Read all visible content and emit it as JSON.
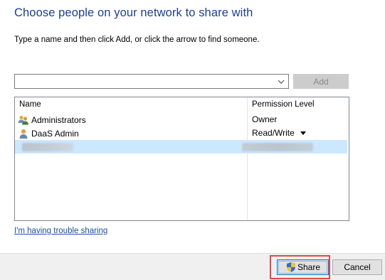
{
  "dialog": {
    "title": "Choose people on your network to share with",
    "instructions": "Type a name and then click Add, or click the arrow to find someone."
  },
  "add_bar": {
    "input_value": "",
    "add_label": "Add"
  },
  "list": {
    "columns": [
      "Name",
      "Permission Level"
    ],
    "rows": [
      {
        "name": "Administrators",
        "permission": "Owner",
        "icon": "group-users-icon"
      },
      {
        "name": "DaaS Admin",
        "permission": "Read/Write",
        "icon": "user-icon",
        "has_dropdown": true
      }
    ]
  },
  "help_link": "I'm having trouble sharing",
  "footer": {
    "share_label": "Share",
    "cancel_label": "Cancel",
    "share_icon": "shield-icon"
  },
  "colors": {
    "title": "#1b3f94",
    "link": "#1e4fa0",
    "selected_row": "#cce8ff",
    "highlight_box": "#e0484b"
  }
}
